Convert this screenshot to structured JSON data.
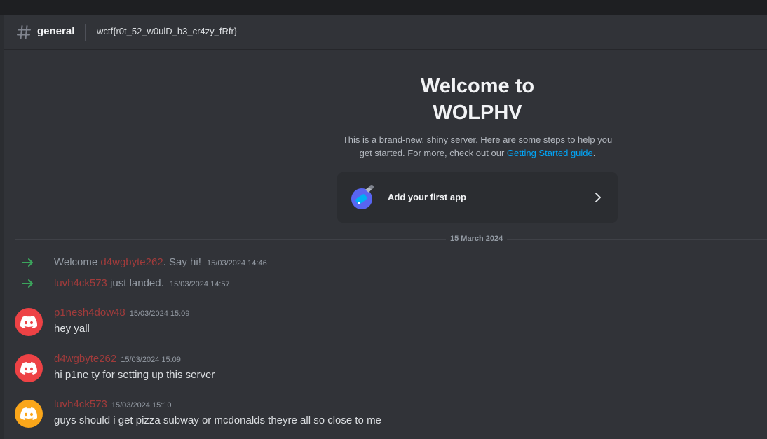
{
  "header": {
    "channel_name": "general",
    "topic": "wctf{r0t_52_w0ulD_b3_cr4zy_fRfr}"
  },
  "welcome": {
    "title_line1": "Welcome to",
    "title_line2": "WOLPHV",
    "desc_part1": "This is a brand-new, shiny server. Here are some steps to help you get started. For more, check out our ",
    "desc_link": "Getting Started guide",
    "desc_end": ".",
    "app_card_label": "Add your first app"
  },
  "date_divider": "15 March 2024",
  "system_messages": [
    {
      "prefix": "Welcome ",
      "user": "d4wgbyte262",
      "suffix": ". Say hi!",
      "timestamp": "15/03/2024 14:46"
    },
    {
      "prefix": "",
      "user": "luvh4ck573",
      "suffix": " just landed.",
      "timestamp": "15/03/2024 14:57"
    }
  ],
  "messages": [
    {
      "author": "p1nesh4dow48",
      "timestamp": "15/03/2024 15:09",
      "text": "hey yall",
      "avatar_color": "#ed4245"
    },
    {
      "author": "d4wgbyte262",
      "timestamp": "15/03/2024 15:09",
      "text": "hi p1ne ty for setting up this server",
      "avatar_color": "#ed4245"
    },
    {
      "author": "luvh4ck573",
      "timestamp": "15/03/2024 15:10",
      "text": "guys should i get pizza subway or mcdonalds theyre all so close to me",
      "avatar_color": "#faa61a"
    }
  ],
  "colors": {
    "background": "#313338",
    "username": "#a13b3b",
    "link": "#00a8fc",
    "join_arrow": "#3ba55c"
  }
}
